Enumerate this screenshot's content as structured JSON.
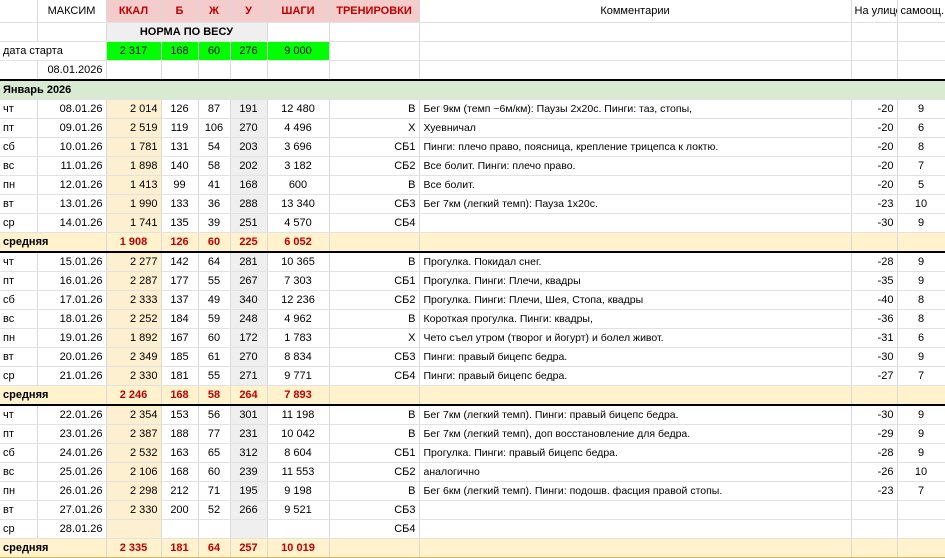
{
  "header": {
    "name": "МАКСИМ",
    "kcal": "ККАЛ",
    "b": "Б",
    "zh": "Ж",
    "u": "У",
    "steps": "ШАГИ",
    "training": "ТРЕНИРОВКИ",
    "comments": "Комментарии",
    "outside": "На улице",
    "feeling": "самоощ."
  },
  "norm": {
    "title": "НОРМА ПО ВЕСУ",
    "start_label": "дата старта",
    "kcal": "2 317",
    "b": "168",
    "zh": "60",
    "u": "276",
    "steps": "9 000",
    "start_date": "08.01.2026"
  },
  "month": "Январь 2026",
  "avg_label": "средняя",
  "weeks": [
    {
      "days": [
        {
          "dow": "чт",
          "date": "08.01.26",
          "kcal": "2 014",
          "b": "126",
          "zh": "87",
          "u": "191",
          "steps": "12 480",
          "train": "В",
          "comment": "Бег 9км (темп ~6м/км): Паузы 2х20с. Пинги: таз, стопы,",
          "temp": "-20",
          "feel": "9"
        },
        {
          "dow": "пт",
          "date": "09.01.26",
          "kcal": "2 519",
          "b": "119",
          "zh": "106",
          "u": "270",
          "steps": "4 496",
          "train": "Х",
          "comment": "Хуевничал",
          "temp": "-20",
          "feel": "6"
        },
        {
          "dow": "сб",
          "date": "10.01.26",
          "kcal": "1 781",
          "b": "131",
          "zh": "54",
          "u": "203",
          "steps": "3 696",
          "train": "СБ1",
          "comment": "Пинги: плечо право, поясница, крепление трицепса к локтю.",
          "temp": "-20",
          "feel": "8"
        },
        {
          "dow": "вс",
          "date": "11.01.26",
          "kcal": "1 898",
          "b": "140",
          "zh": "58",
          "u": "202",
          "steps": "3 182",
          "train": "СБ2",
          "comment": "Все болит. Пинги: плечо право.",
          "temp": "-20",
          "feel": "7"
        },
        {
          "dow": "пн",
          "date": "12.01.26",
          "kcal": "1 413",
          "b": "99",
          "zh": "41",
          "u": "168",
          "steps": "600",
          "train": "В",
          "comment": "Все болит.",
          "temp": "-20",
          "feel": "5"
        },
        {
          "dow": "вт",
          "date": "13.01.26",
          "kcal": "1 990",
          "b": "133",
          "zh": "36",
          "u": "288",
          "steps": "13 340",
          "train": "СБ3",
          "comment": "Бег 7км (легкий темп): Пауза 1х20с.",
          "temp": "-23",
          "feel": "10"
        },
        {
          "dow": "ср",
          "date": "14.01.26",
          "kcal": "1 741",
          "b": "135",
          "zh": "39",
          "u": "251",
          "steps": "4 570",
          "train": "СБ4",
          "comment": "",
          "temp": "-30",
          "feel": "9"
        }
      ],
      "avg": {
        "kcal": "1 908",
        "b": "126",
        "zh": "60",
        "u": "225",
        "steps": "6 052"
      }
    },
    {
      "days": [
        {
          "dow": "чт",
          "date": "15.01.26",
          "kcal": "2 277",
          "b": "142",
          "zh": "64",
          "u": "281",
          "steps": "10 365",
          "train": "В",
          "comment": "Прогулка. Покидал снег.",
          "temp": "-28",
          "feel": "9"
        },
        {
          "dow": "пт",
          "date": "16.01.26",
          "kcal": "2 287",
          "b": "177",
          "zh": "55",
          "u": "267",
          "steps": "7 303",
          "train": "СБ1",
          "comment": "Прогулка. Пинги: Плечи, квадры",
          "temp": "-35",
          "feel": "9"
        },
        {
          "dow": "сб",
          "date": "17.01.26",
          "kcal": "2 333",
          "b": "137",
          "zh": "49",
          "u": "340",
          "steps": "12 236",
          "train": "СБ2",
          "comment": "Прогулка. Пинги: Плечи, Шея, Стопа, квадры",
          "temp": "-40",
          "feel": "8"
        },
        {
          "dow": "вс",
          "date": "18.01.26",
          "kcal": "2 252",
          "b": "184",
          "zh": "59",
          "u": "248",
          "steps": "4 962",
          "train": "В",
          "comment": "Короткая прогулка. Пинги: квадры,",
          "temp": "-36",
          "feel": "8"
        },
        {
          "dow": "пн",
          "date": "19.01.26",
          "kcal": "1 892",
          "b": "167",
          "zh": "60",
          "u": "172",
          "steps": "1 783",
          "train": "Х",
          "comment": "Чето съел утром (творог и йогурт) и болел живот.",
          "temp": "-31",
          "feel": "6"
        },
        {
          "dow": "вт",
          "date": "20.01.26",
          "kcal": "2 349",
          "b": "185",
          "zh": "61",
          "u": "270",
          "steps": "8 834",
          "train": "СБ3",
          "comment": "Пинги: правый бицепс бедра.",
          "temp": "-30",
          "feel": "9"
        },
        {
          "dow": "ср",
          "date": "21.01.26",
          "kcal": "2 330",
          "b": "181",
          "zh": "55",
          "u": "271",
          "steps": "9 771",
          "train": "СБ4",
          "comment": "Пинги: правый бицепс бедра.",
          "temp": "-27",
          "feel": "7"
        }
      ],
      "avg": {
        "kcal": "2 246",
        "b": "168",
        "zh": "58",
        "u": "264",
        "steps": "7 893"
      }
    },
    {
      "days": [
        {
          "dow": "чт",
          "date": "22.01.26",
          "kcal": "2 354",
          "b": "153",
          "zh": "56",
          "u": "301",
          "steps": "11 198",
          "train": "В",
          "comment": "Бег 7км (легкий темп). Пинги: правый бицепс бедра.",
          "temp": "-30",
          "feel": "9"
        },
        {
          "dow": "пт",
          "date": "23.01.26",
          "kcal": "2 387",
          "b": "188",
          "zh": "77",
          "u": "231",
          "steps": "10 042",
          "train": "В",
          "comment": "Бег 7км (легкий темп), доп восстановление для бедра.",
          "temp": "-29",
          "feel": "9"
        },
        {
          "dow": "сб",
          "date": "24.01.26",
          "kcal": "2 532",
          "b": "163",
          "zh": "65",
          "u": "312",
          "steps": "8 604",
          "train": "СБ1",
          "comment": "Прогулка. Пинги: правый бицепс бедра.",
          "temp": "-28",
          "feel": "9"
        },
        {
          "dow": "вс",
          "date": "25.01.26",
          "kcal": "2 106",
          "b": "168",
          "zh": "60",
          "u": "239",
          "steps": "11 553",
          "train": "СБ2",
          "comment": "аналогично",
          "temp": "-26",
          "feel": "10"
        },
        {
          "dow": "пн",
          "date": "26.01.26",
          "kcal": "2 298",
          "b": "212",
          "zh": "71",
          "u": "195",
          "steps": "9 198",
          "train": "В",
          "comment": "Бег 6км (легкий темп). Пинги: подошв. фасция правой стопы.",
          "temp": "-23",
          "feel": "7"
        },
        {
          "dow": "вт",
          "date": "27.01.26",
          "kcal": "2 330",
          "b": "200",
          "zh": "52",
          "u": "266",
          "steps": "9 521",
          "train": "СБ3",
          "comment": "",
          "temp": "",
          "feel": ""
        },
        {
          "dow": "ср",
          "date": "28.01.26",
          "kcal": "",
          "b": "",
          "zh": "",
          "u": "",
          "steps": "",
          "train": "СБ4",
          "comment": "",
          "temp": "",
          "feel": ""
        }
      ],
      "avg": {
        "kcal": "2 335",
        "b": "181",
        "zh": "64",
        "u": "257",
        "steps": "10 019"
      }
    }
  ]
}
